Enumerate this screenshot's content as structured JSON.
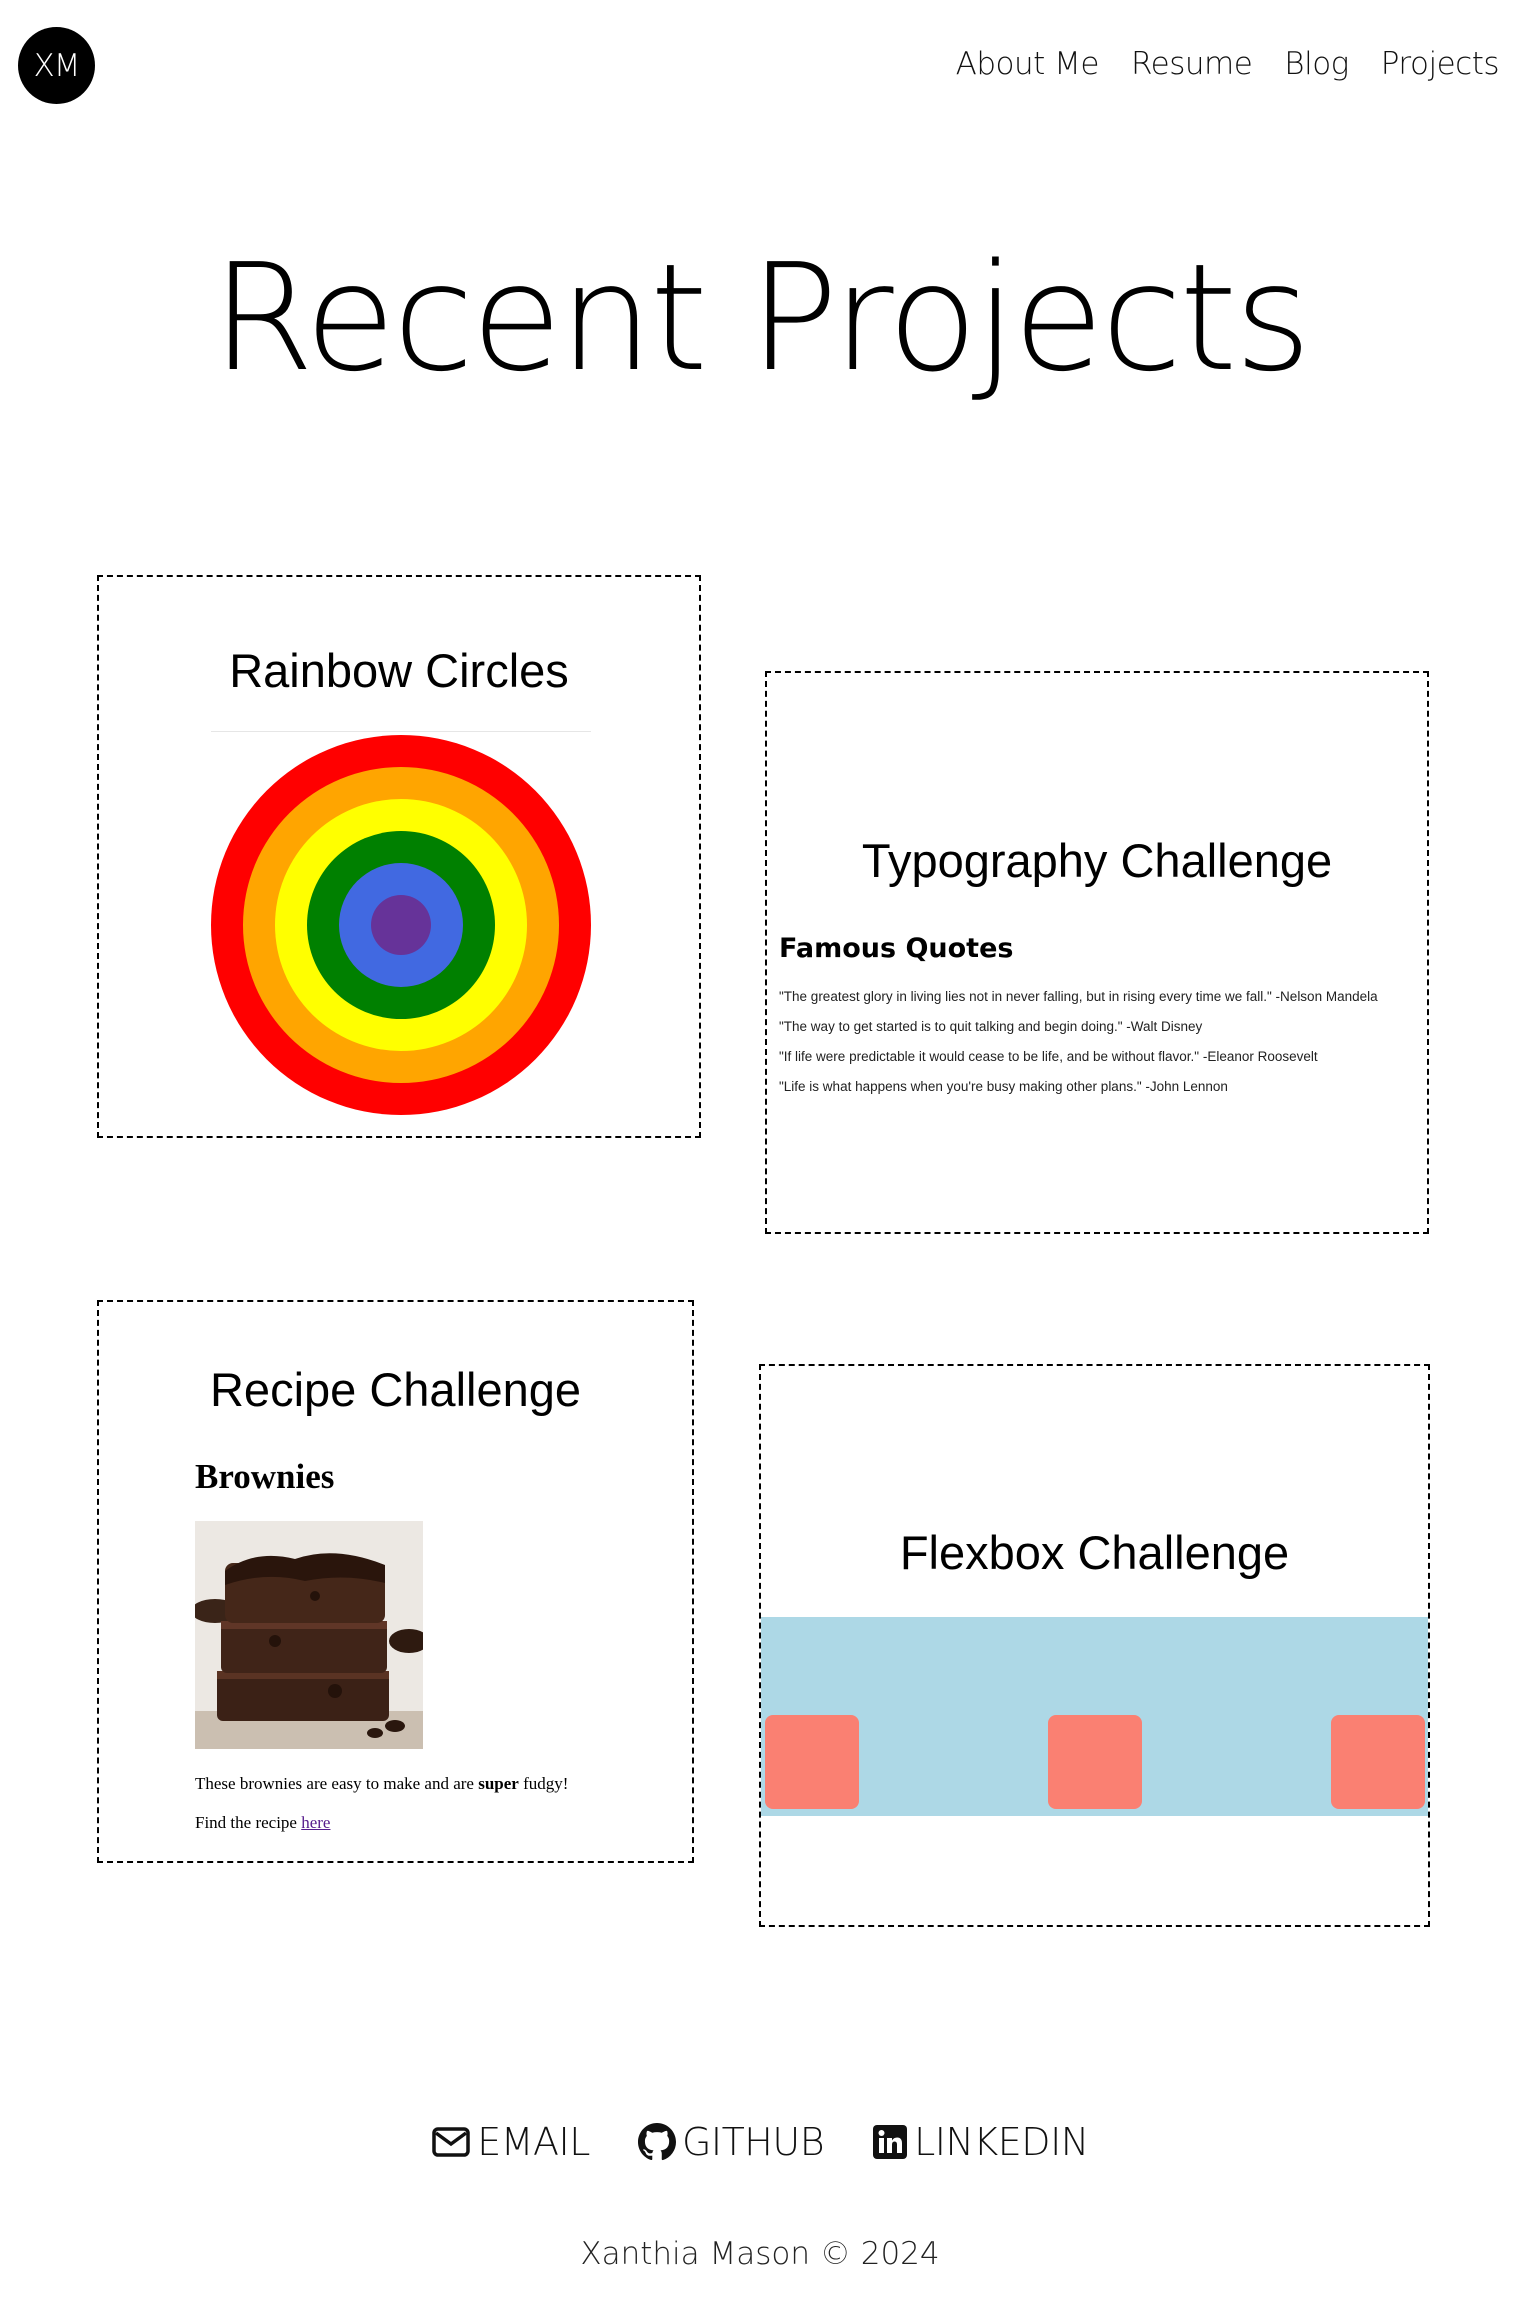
{
  "header": {
    "logo_text": "XM",
    "nav": [
      {
        "label": "About Me"
      },
      {
        "label": "Resume"
      },
      {
        "label": "Blog"
      },
      {
        "label": "Projects"
      }
    ]
  },
  "page_title": "Recent Projects",
  "projects": {
    "rainbow": {
      "title": "Rainbow Circles",
      "ring_colors": [
        "#ff0000",
        "#ffa500",
        "#ffff00",
        "#008000",
        "#4169e1",
        "#663399"
      ]
    },
    "typography": {
      "title": "Typography Challenge",
      "heading": "Famous Quotes",
      "quotes": [
        "\"The greatest glory in living lies not in never falling, but in rising every time we fall.\" -Nelson Mandela",
        "\"The way to get started is to quit talking and begin doing.\" -Walt Disney",
        "\"If life were predictable it would cease to be life, and be without flavor.\" -Eleanor Roosevelt",
        "\"Life is what happens when you're busy making other plans.\" -John Lennon"
      ]
    },
    "recipe": {
      "title": "Recipe Challenge",
      "heading": "Brownies",
      "desc_before": "These brownies are easy to make and are ",
      "desc_bold": "super",
      "desc_after": " fudgy!",
      "find_text": "Find the recipe ",
      "link_text": "here"
    },
    "flexbox": {
      "title": "Flexbox Challenge",
      "container_color": "#add8e6",
      "box_color": "#fa8072"
    }
  },
  "footer": {
    "links": [
      {
        "label": "EMAIL",
        "icon": "envelope-icon"
      },
      {
        "label": "GITHUB",
        "icon": "github-icon"
      },
      {
        "label": "LINKEDIN",
        "icon": "linkedin-icon"
      }
    ],
    "copyright": "Xanthia Mason © 2024"
  }
}
